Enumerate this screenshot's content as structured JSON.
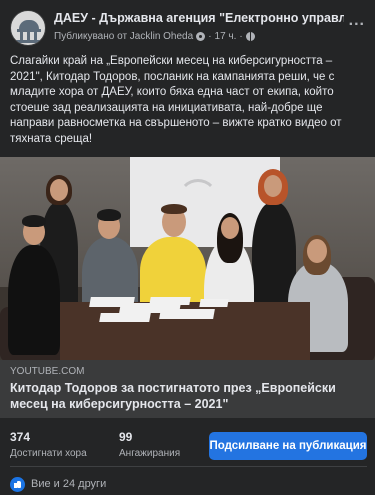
{
  "post": {
    "page_name": "ДАЕУ - Държавна агенция \"Електронно управление\"",
    "published_by": "Публикувано от Jacklin Oheda",
    "time": "17 ч.",
    "more_label": "...",
    "text": "Слагайки край на „Европейски месец на киберсигурността – 2021\", Китодар Тодоров, посланик на кампанията реши, че с младите хора от ДАЕУ, които бяха една част от екипа, който стоеше зад реализацията на инициативата, най-добре ще направи равносметка на свършеното – вижте кратко видео от тяхната среща!"
  },
  "link": {
    "domain": "YOUTUBE.COM",
    "title": "Китодар Тодоров за постигнатото през „Европейски месец на киберсигурността – 2021\""
  },
  "stats": {
    "reached_count": "374",
    "reached_label": "Достигнати хора",
    "engagements_count": "99",
    "engagements_label": "Ангажирания",
    "promote_label": "Подсилване на публикация"
  },
  "reactions": {
    "text": "Вие и 24 други"
  },
  "colors": {
    "background": "#242526",
    "link_bar": "#3a3b3c",
    "accent": "#2374e1",
    "like": "#1b74e4"
  },
  "icons": [
    "avatar-logo",
    "gear-icon",
    "globe-icon",
    "more-options-icon",
    "like-icon"
  ]
}
